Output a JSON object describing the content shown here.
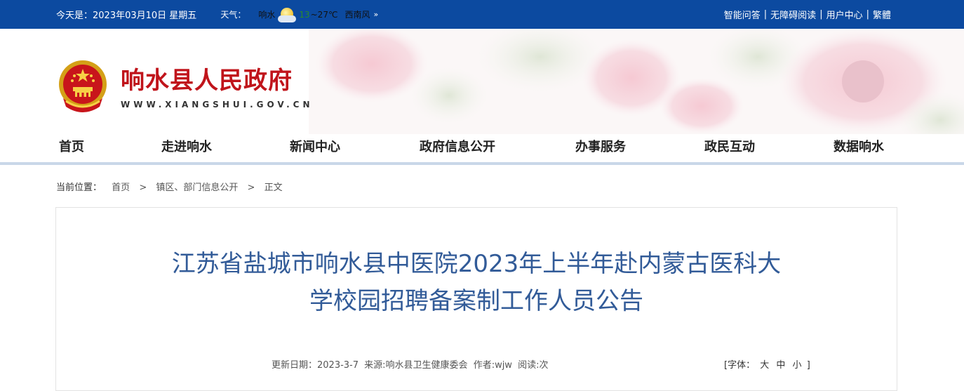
{
  "topbar": {
    "date": "今天是：2023年03月10日 星期五",
    "weather_label": "天气：",
    "city": "响水",
    "weather_icon": "sun-cloud-icon",
    "temp_low": "13",
    "temp_rest": "~27℃",
    "wind": "西南风",
    "more": "»",
    "links": [
      "智能问答",
      "无障碍阅读",
      "用户中心",
      "繁體"
    ],
    "separator": "|"
  },
  "header": {
    "site_title": "响水县人民政府",
    "site_url": "WWW.XIANGSHUI.GOV.CN",
    "emblem": "national-emblem"
  },
  "nav": {
    "items": [
      "首页",
      "走进响水",
      "新闻中心",
      "政府信息公开",
      "办事服务",
      "政民互动",
      "数据响水"
    ]
  },
  "breadcrumb": {
    "label": "当前位置：",
    "items": [
      "首页",
      "镇区、部门信息公开",
      "正文"
    ],
    "separator": ">"
  },
  "article": {
    "title_line1": "江苏省盐城市响水县中医院2023年上半年赴内蒙古医科大",
    "title_line2": "学校园招聘备案制工作人员公告",
    "updated": "更新日期：2023-3-7",
    "source": "来源:响水县卫生健康委会",
    "author": "作者:wjw",
    "reads": "阅读:次",
    "font_label": "[字体：",
    "font_options": [
      "大",
      "中",
      "小"
    ],
    "font_close": "]"
  },
  "colors": {
    "topbar_bg": "#0c4aa0",
    "site_title": "#c0141b",
    "article_title": "#325b98",
    "nav_line": "#c9d7e8"
  }
}
